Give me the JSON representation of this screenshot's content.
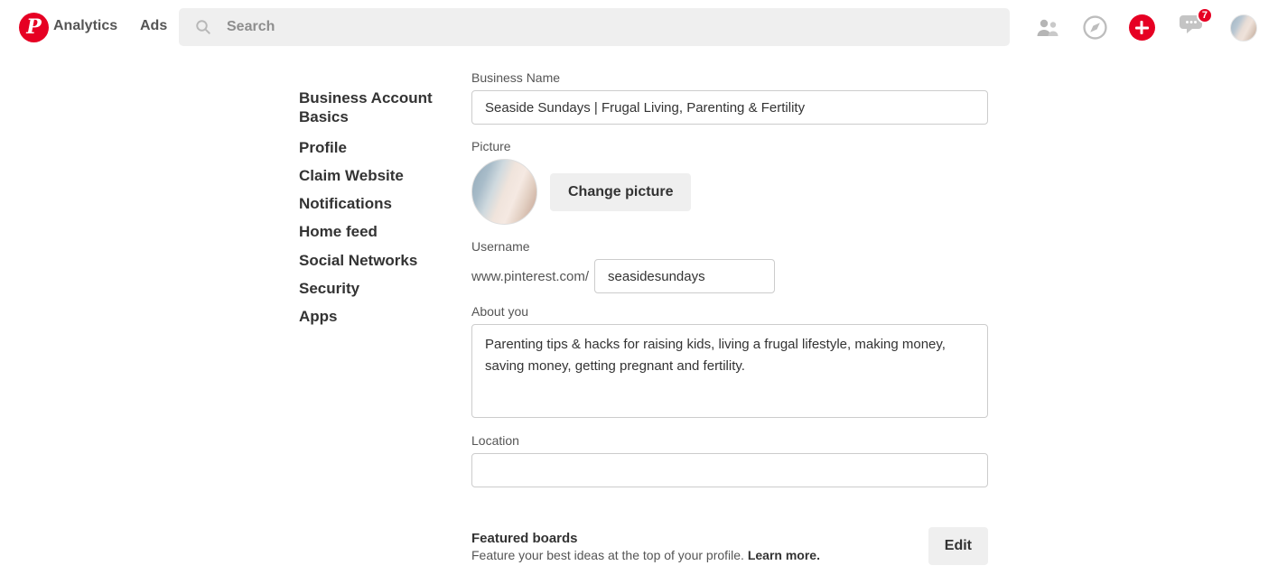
{
  "header": {
    "logo_glyph": "P",
    "nav": [
      {
        "label": "Analytics",
        "name": "nav-analytics"
      },
      {
        "label": "Ads",
        "name": "nav-ads"
      }
    ],
    "search": {
      "placeholder": "Search",
      "value": ""
    },
    "icons": [
      {
        "name": "people-icon",
        "label": "People"
      },
      {
        "name": "compass-icon",
        "label": "Explore"
      },
      {
        "name": "plus-icon",
        "label": "Create"
      },
      {
        "name": "messages-icon",
        "label": "Messages"
      },
      {
        "name": "avatar",
        "label": "Account"
      }
    ],
    "messages_badge": "7",
    "accent_color": "#e60023",
    "search_bg": "#efefef"
  },
  "sidebar": {
    "items": [
      {
        "label": "Business Account Basics"
      },
      {
        "label": "Profile"
      },
      {
        "label": "Claim Website"
      },
      {
        "label": "Notifications"
      },
      {
        "label": "Home feed"
      },
      {
        "label": "Social Networks"
      },
      {
        "label": "Security"
      },
      {
        "label": "Apps"
      }
    ]
  },
  "form": {
    "business_name": {
      "label": "Business Name",
      "value": "Seaside Sundays | Frugal Living, Parenting & Fertility",
      "placeholder": ""
    },
    "picture": {
      "label": "Picture",
      "change_button": "Change picture"
    },
    "username": {
      "label": "Username",
      "prefix": "www.pinterest.com/",
      "value": "seasidesundays",
      "placeholder": ""
    },
    "about": {
      "label": "About you",
      "value": "Parenting tips & hacks for raising kids, living a frugal lifestyle, making money, saving money, getting pregnant and fertility.",
      "placeholder": ""
    },
    "location": {
      "label": "Location",
      "value": "",
      "placeholder": ""
    },
    "featured_boards": {
      "title": "Featured boards",
      "description": "Feature your best ideas at the top of your profile.",
      "learn_more": "Learn more.",
      "edit_button": "Edit"
    }
  }
}
